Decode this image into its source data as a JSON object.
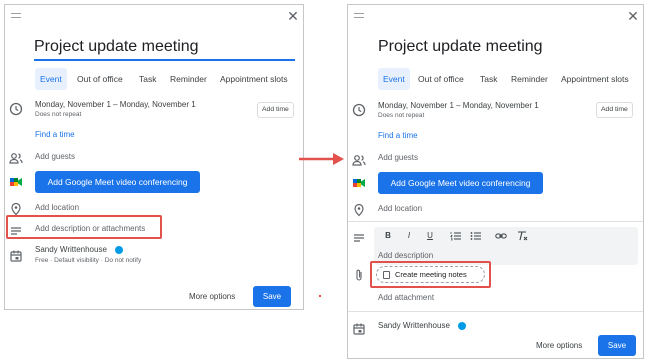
{
  "left_panel": {
    "title": "Project update meeting",
    "tabs": [
      "Event",
      "Out of office",
      "Task",
      "Reminder",
      "Appointment slots"
    ],
    "date_range": "Monday, November 1   –   Monday, November 1",
    "repeat": "Does not repeat",
    "add_time": "Add time",
    "find_time": "Find a time",
    "add_guests": "Add guests",
    "meet_button": "Add Google Meet video conferencing",
    "add_location": "Add location",
    "add_description": "Add description or attachments",
    "calendar_owner": "Sandy Writtenhouse",
    "calendar_details": "Free · Default visibility · Do not notify",
    "more_options": "More options",
    "save": "Save"
  },
  "right_panel": {
    "title": "Project update meeting",
    "tabs": [
      "Event",
      "Out of office",
      "Task",
      "Reminder",
      "Appointment slots"
    ],
    "date_range": "Monday, November 1   –   Monday, November 1",
    "repeat": "Does not repeat",
    "add_time": "Add time",
    "find_time": "Find a time",
    "add_guests": "Add guests",
    "meet_button": "Add Google Meet video conferencing",
    "add_location": "Add location",
    "format_buttons": [
      "B",
      "I",
      "U"
    ],
    "description_placeholder": "Add description",
    "create_notes": "Create meeting notes",
    "add_attachment": "Add attachment",
    "calendar_owner": "Sandy Writtenhouse",
    "more_options": "More options",
    "save": "Save"
  },
  "colors": {
    "accent": "#1a73e8",
    "highlight": "#e2514c",
    "calendar_dot": "#039be5"
  }
}
